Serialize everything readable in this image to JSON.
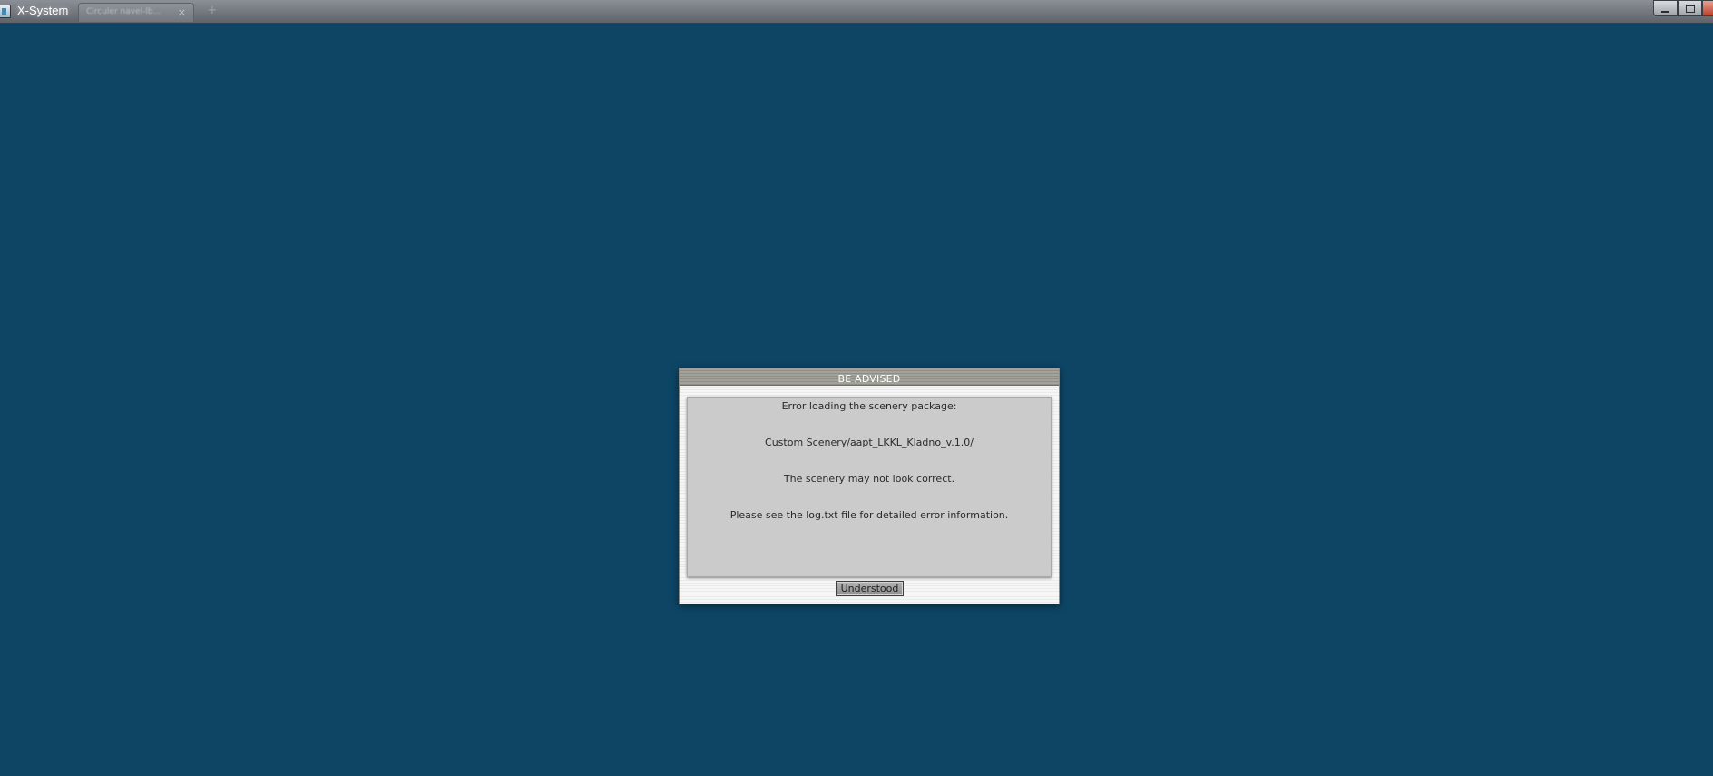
{
  "window": {
    "title": "X-System",
    "tab_label": "Circuler navel-lb...",
    "tab_close": "×",
    "new_tab": "+",
    "icons": {
      "app": "x-system-app-icon",
      "minimize": "minimize-icon",
      "maximize": "maximize-icon",
      "close": "close-icon"
    }
  },
  "desktop": {
    "background_color": "#0e4565"
  },
  "dialog": {
    "title": "BE ADVISED",
    "messages": [
      "Error loading the scenery package:",
      "Custom Scenery/aapt_LKKL_Kladno_v.1.0/",
      "The scenery may not look correct.",
      "Please see the log.txt file for detailed error information."
    ],
    "button_label": "Understood"
  }
}
